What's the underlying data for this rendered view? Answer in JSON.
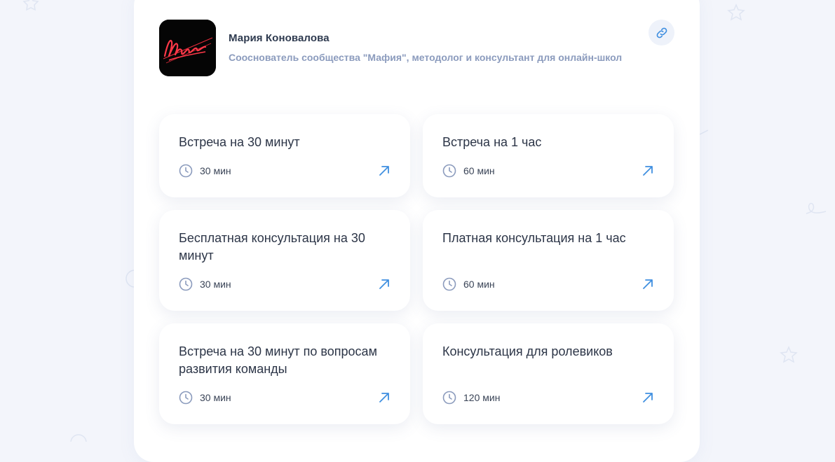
{
  "colors": {
    "page_bg": "#f3f5fb",
    "accent": "#3f8fe0",
    "icon_muted": "#8b9bbd"
  },
  "profile": {
    "logo_text": "Мафия",
    "name": "Мария Коновалова",
    "description": "Сооснователь сообщества \"Мафия\", методолог и консультант для онлайн-школ",
    "link_icon": "link-icon"
  },
  "events": [
    {
      "title": "Встреча на 30 минут",
      "duration": "30 мин",
      "icon": "clock-icon",
      "action_icon": "arrow-up-right-icon"
    },
    {
      "title": "Встреча на 1 час",
      "duration": "60 мин",
      "icon": "clock-icon",
      "action_icon": "arrow-up-right-icon"
    },
    {
      "title": "Бесплатная консультация на 30 минут",
      "duration": "30 мин",
      "icon": "clock-icon",
      "action_icon": "arrow-up-right-icon"
    },
    {
      "title": "Платная консультация на 1 час",
      "duration": "60 мин",
      "icon": "clock-icon",
      "action_icon": "arrow-up-right-icon"
    },
    {
      "title": "Встреча на 30 минут по вопросам развития команды",
      "duration": "30 мин",
      "icon": "clock-icon",
      "action_icon": "arrow-up-right-icon"
    },
    {
      "title": "Консультация для ролевиков",
      "duration": "120 мин",
      "icon": "clock-icon",
      "action_icon": "arrow-up-right-icon"
    }
  ]
}
